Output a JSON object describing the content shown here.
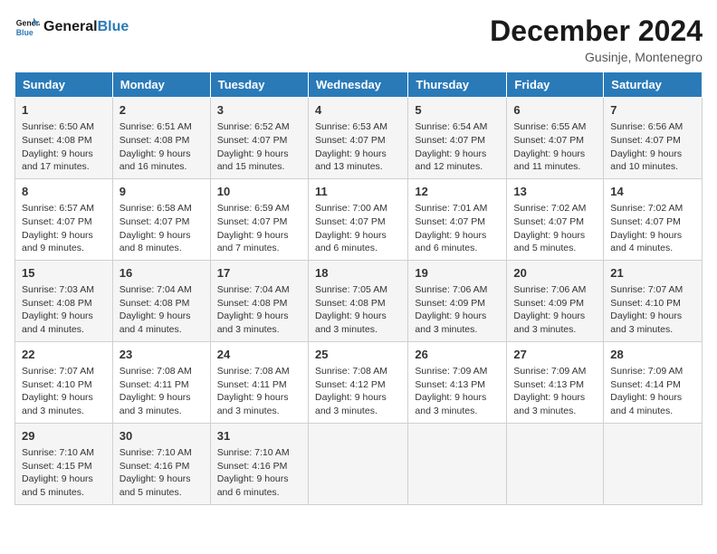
{
  "logo": {
    "line1": "General",
    "line2": "Blue"
  },
  "title": "December 2024",
  "location": "Gusinje, Montenegro",
  "days_of_week": [
    "Sunday",
    "Monday",
    "Tuesday",
    "Wednesday",
    "Thursday",
    "Friday",
    "Saturday"
  ],
  "weeks": [
    [
      {
        "day": "1",
        "sunrise": "6:50 AM",
        "sunset": "4:08 PM",
        "daylight_hours": "9 hours and 17 minutes."
      },
      {
        "day": "2",
        "sunrise": "6:51 AM",
        "sunset": "4:08 PM",
        "daylight_hours": "9 hours and 16 minutes."
      },
      {
        "day": "3",
        "sunrise": "6:52 AM",
        "sunset": "4:07 PM",
        "daylight_hours": "9 hours and 15 minutes."
      },
      {
        "day": "4",
        "sunrise": "6:53 AM",
        "sunset": "4:07 PM",
        "daylight_hours": "9 hours and 13 minutes."
      },
      {
        "day": "5",
        "sunrise": "6:54 AM",
        "sunset": "4:07 PM",
        "daylight_hours": "9 hours and 12 minutes."
      },
      {
        "day": "6",
        "sunrise": "6:55 AM",
        "sunset": "4:07 PM",
        "daylight_hours": "9 hours and 11 minutes."
      },
      {
        "day": "7",
        "sunrise": "6:56 AM",
        "sunset": "4:07 PM",
        "daylight_hours": "9 hours and 10 minutes."
      }
    ],
    [
      {
        "day": "8",
        "sunrise": "6:57 AM",
        "sunset": "4:07 PM",
        "daylight_hours": "9 hours and 9 minutes."
      },
      {
        "day": "9",
        "sunrise": "6:58 AM",
        "sunset": "4:07 PM",
        "daylight_hours": "9 hours and 8 minutes."
      },
      {
        "day": "10",
        "sunrise": "6:59 AM",
        "sunset": "4:07 PM",
        "daylight_hours": "9 hours and 7 minutes."
      },
      {
        "day": "11",
        "sunrise": "7:00 AM",
        "sunset": "4:07 PM",
        "daylight_hours": "9 hours and 6 minutes."
      },
      {
        "day": "12",
        "sunrise": "7:01 AM",
        "sunset": "4:07 PM",
        "daylight_hours": "9 hours and 6 minutes."
      },
      {
        "day": "13",
        "sunrise": "7:02 AM",
        "sunset": "4:07 PM",
        "daylight_hours": "9 hours and 5 minutes."
      },
      {
        "day": "14",
        "sunrise": "7:02 AM",
        "sunset": "4:07 PM",
        "daylight_hours": "9 hours and 4 minutes."
      }
    ],
    [
      {
        "day": "15",
        "sunrise": "7:03 AM",
        "sunset": "4:08 PM",
        "daylight_hours": "9 hours and 4 minutes."
      },
      {
        "day": "16",
        "sunrise": "7:04 AM",
        "sunset": "4:08 PM",
        "daylight_hours": "9 hours and 4 minutes."
      },
      {
        "day": "17",
        "sunrise": "7:04 AM",
        "sunset": "4:08 PM",
        "daylight_hours": "9 hours and 3 minutes."
      },
      {
        "day": "18",
        "sunrise": "7:05 AM",
        "sunset": "4:08 PM",
        "daylight_hours": "9 hours and 3 minutes."
      },
      {
        "day": "19",
        "sunrise": "7:06 AM",
        "sunset": "4:09 PM",
        "daylight_hours": "9 hours and 3 minutes."
      },
      {
        "day": "20",
        "sunrise": "7:06 AM",
        "sunset": "4:09 PM",
        "daylight_hours": "9 hours and 3 minutes."
      },
      {
        "day": "21",
        "sunrise": "7:07 AM",
        "sunset": "4:10 PM",
        "daylight_hours": "9 hours and 3 minutes."
      }
    ],
    [
      {
        "day": "22",
        "sunrise": "7:07 AM",
        "sunset": "4:10 PM",
        "daylight_hours": "9 hours and 3 minutes."
      },
      {
        "day": "23",
        "sunrise": "7:08 AM",
        "sunset": "4:11 PM",
        "daylight_hours": "9 hours and 3 minutes."
      },
      {
        "day": "24",
        "sunrise": "7:08 AM",
        "sunset": "4:11 PM",
        "daylight_hours": "9 hours and 3 minutes."
      },
      {
        "day": "25",
        "sunrise": "7:08 AM",
        "sunset": "4:12 PM",
        "daylight_hours": "9 hours and 3 minutes."
      },
      {
        "day": "26",
        "sunrise": "7:09 AM",
        "sunset": "4:13 PM",
        "daylight_hours": "9 hours and 3 minutes."
      },
      {
        "day": "27",
        "sunrise": "7:09 AM",
        "sunset": "4:13 PM",
        "daylight_hours": "9 hours and 3 minutes."
      },
      {
        "day": "28",
        "sunrise": "7:09 AM",
        "sunset": "4:14 PM",
        "daylight_hours": "9 hours and 4 minutes."
      }
    ],
    [
      {
        "day": "29",
        "sunrise": "7:10 AM",
        "sunset": "4:15 PM",
        "daylight_hours": "9 hours and 5 minutes."
      },
      {
        "day": "30",
        "sunrise": "7:10 AM",
        "sunset": "4:16 PM",
        "daylight_hours": "9 hours and 5 minutes."
      },
      {
        "day": "31",
        "sunrise": "7:10 AM",
        "sunset": "4:16 PM",
        "daylight_hours": "9 hours and 6 minutes."
      },
      null,
      null,
      null,
      null
    ]
  ],
  "labels": {
    "sunrise": "Sunrise:",
    "sunset": "Sunset:",
    "daylight": "Daylight:"
  }
}
